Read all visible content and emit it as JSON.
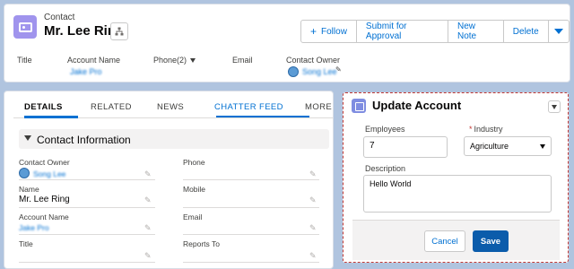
{
  "header": {
    "object_label": "Contact",
    "record_name": "Mr. Lee Ring",
    "hierarchy_icon": "hierarchy-icon",
    "actions": {
      "follow": "Follow",
      "submit_for_approval": "Submit for Approval",
      "new_note": "New Note",
      "delete": "Delete"
    },
    "highlights": {
      "title_label": "Title",
      "account_name_label": "Account Name",
      "account_name_value": "Jake Pro",
      "phone_label": "Phone(2)",
      "email_label": "Email",
      "contact_owner_label": "Contact Owner",
      "contact_owner_value": "Song Lee"
    }
  },
  "tabs": [
    "DETAILS",
    "RELATED",
    "NEWS",
    "CHATTER FEED",
    "MORE"
  ],
  "details": {
    "section_title": "Contact Information",
    "contact_owner_label": "Contact Owner",
    "contact_owner_value": "Song Lee",
    "phone_label": "Phone",
    "name_label": "Name",
    "name_value": "Mr. Lee Ring",
    "mobile_label": "Mobile",
    "account_name_label": "Account Name",
    "account_name_value": "Jake Pro",
    "email_label": "Email",
    "title_label": "Title",
    "reports_to_label": "Reports To"
  },
  "update_account": {
    "title": "Update Account",
    "employees_label": "Employees",
    "employees_value": "7",
    "industry_label": "Industry",
    "industry_required_marker": "*",
    "industry_value": "Agriculture",
    "description_label": "Description",
    "description_value": "Hello World",
    "cancel_label": "Cancel",
    "save_label": "Save"
  },
  "colors": {
    "brand": "#0070d2",
    "contact_icon": "#a094ed",
    "save_button": "#0b5cab",
    "highlight_border": "#c23934"
  }
}
